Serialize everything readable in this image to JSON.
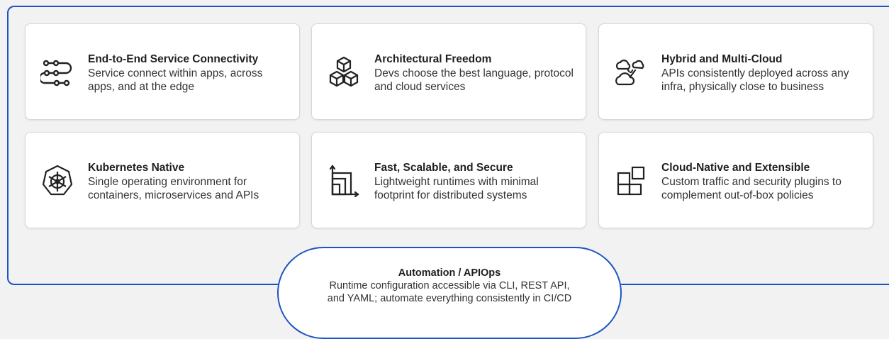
{
  "cards": [
    {
      "title": "End-to-End Service Connectivity",
      "desc": "Service connect within apps, across apps, and at the edge",
      "icon": "connectivity-icon"
    },
    {
      "title": "Architectural Freedom",
      "desc": "Devs choose the best language, protocol and cloud services",
      "icon": "cubes-icon"
    },
    {
      "title": "Hybrid and Multi-Cloud",
      "desc": "APIs consistently deployed across any infra, physically close to business",
      "icon": "clouds-icon"
    },
    {
      "title": "Kubernetes Native",
      "desc": "Single operating environment for containers, microservices and APIs",
      "icon": "kubernetes-icon"
    },
    {
      "title": "Fast, Scalable, and Secure",
      "desc": "Lightweight runtimes with minimal footprint for distributed systems",
      "icon": "scale-chart-icon"
    },
    {
      "title": "Cloud-Native and Extensible",
      "desc": "Custom traffic and security plugins to complement out-of-box policies",
      "icon": "plugin-blocks-icon"
    }
  ],
  "automation": {
    "title": "Automation / APIOps",
    "desc_line1": "Runtime configuration accessible via CLI, REST API,",
    "desc_line2": "and YAML; automate everything consistently in CI/CD"
  },
  "colors": {
    "accent": "#1b54c4",
    "background": "#f2f2f2",
    "card": "#ffffff"
  }
}
